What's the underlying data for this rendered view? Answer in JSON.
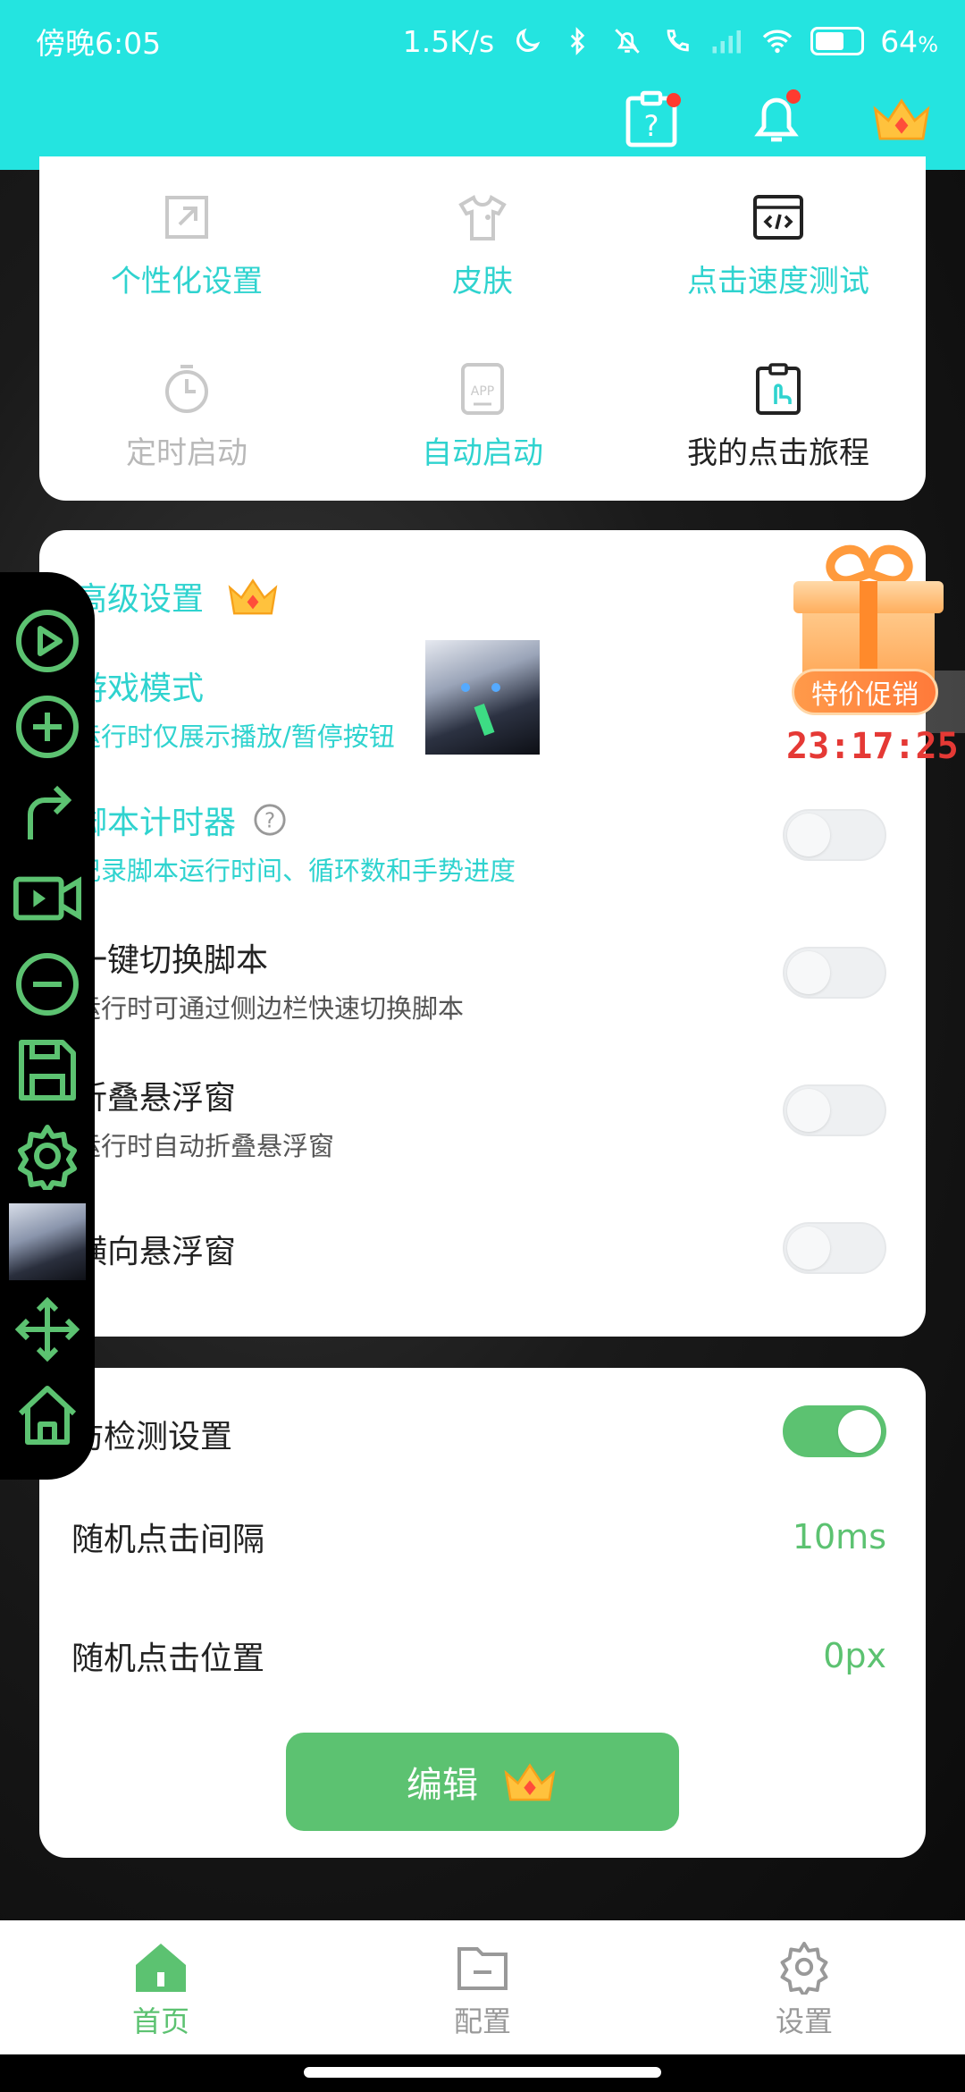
{
  "status": {
    "time": "傍晚6:05",
    "speed": "1.5K/s",
    "battery": "64",
    "battery_unit": "%",
    "battery_level": 0.64
  },
  "header": {
    "icons": [
      "help-icon",
      "notification-icon",
      "vip-crown-icon"
    ]
  },
  "tools": [
    {
      "label": "个性化设置",
      "icon": "external-link-icon",
      "state": "teal"
    },
    {
      "label": "皮肤",
      "icon": "tshirt-icon",
      "state": "teal"
    },
    {
      "label": "点击速度测试",
      "icon": "code-window-icon",
      "state": "teal"
    },
    {
      "label": "定时启动",
      "icon": "timer-icon",
      "state": "gray"
    },
    {
      "label": "自动启动",
      "icon": "app-icon",
      "state": "teal"
    },
    {
      "label": "我的点击旅程",
      "icon": "clipboard-touch-icon",
      "state": "dark"
    }
  ],
  "advanced": {
    "title": "高级设置",
    "rows": [
      {
        "title": "游戏模式",
        "subtitle": "运行时仅展示播放/暂停按钮",
        "enabled": false
      },
      {
        "title": "脚本计时器",
        "subtitle": "记录脚本运行时间、循环数和手势进度",
        "enabled": false
      },
      {
        "title": "一键切换脚本",
        "subtitle": "运行时可通过侧边栏快速切换脚本",
        "enabled": false
      },
      {
        "title": "折叠悬浮窗",
        "subtitle": "运行时自动折叠悬浮窗",
        "enabled": false
      },
      {
        "title": "横向悬浮窗",
        "subtitle": "",
        "enabled": false
      }
    ]
  },
  "anti_detect": {
    "title": "防检测设置",
    "enabled": true,
    "interval_label": "随机点击间隔",
    "interval_value": "10ms",
    "position_label": "随机点击位置",
    "position_value": "0px",
    "edit_label": "编辑"
  },
  "promo": {
    "label": "特价促销",
    "countdown": "23:17:25"
  },
  "sidebar": {
    "icons": [
      "play-icon",
      "add-icon",
      "redo-icon",
      "record-icon",
      "remove-icon",
      "save-icon",
      "settings-icon",
      "avatar",
      "move-icon",
      "home-icon"
    ]
  },
  "bottom_nav": [
    {
      "label": "首页",
      "icon": "home-icon",
      "active": true
    },
    {
      "label": "配置",
      "icon": "folder-icon",
      "active": false
    },
    {
      "label": "设置",
      "icon": "gear-icon",
      "active": false
    }
  ],
  "colors": {
    "accent": "#24e4e0",
    "teal_text": "#2fd3cf",
    "green": "#5cc271",
    "countdown_red": "#e53935"
  }
}
